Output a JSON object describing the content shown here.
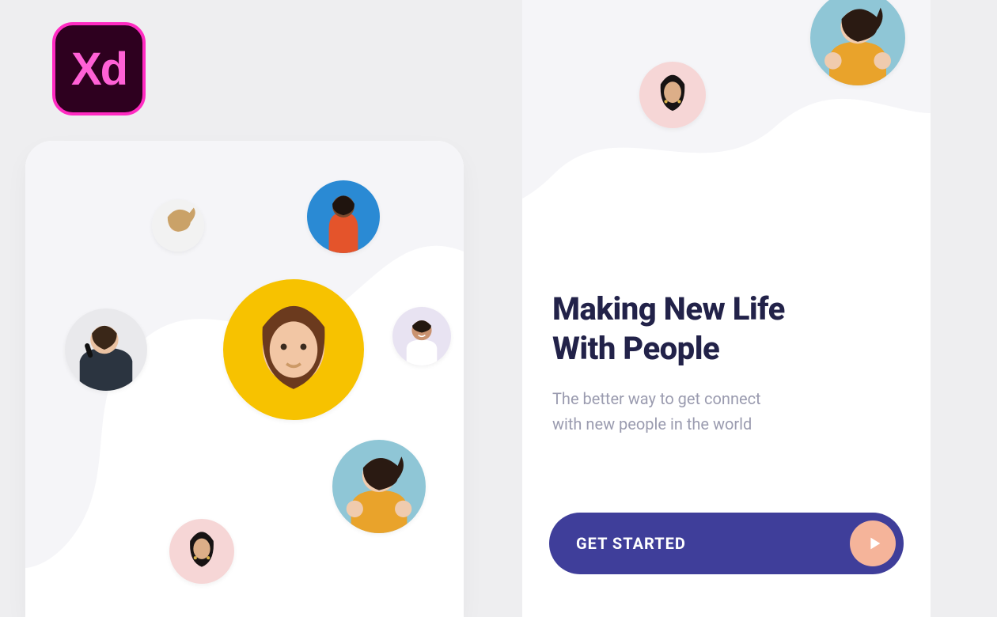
{
  "app_badge": {
    "label": "Xd"
  },
  "left_card": {
    "avatars": {
      "center": "avatar-center",
      "top_right": "avatar-orange",
      "top_left": "avatar-blonde",
      "mid_left": "avatar-phone",
      "mid_right": "avatar-smile",
      "bot_right": "avatar-thumbs",
      "bot_left": "avatar-earrings"
    }
  },
  "right_card": {
    "avatars": {
      "small": "avatar-earrings",
      "large": "avatar-thumbs"
    },
    "headline": "Making New Life\nWith People",
    "subtext": "The better way to get connect\nwith new people in the world",
    "cta_label": "GET STARTED"
  },
  "colors": {
    "primary": "#3f3e9a",
    "accent": "#f5b49a",
    "heading": "#222249",
    "muted": "#9a9baf",
    "blob": "#f5f5f8"
  }
}
